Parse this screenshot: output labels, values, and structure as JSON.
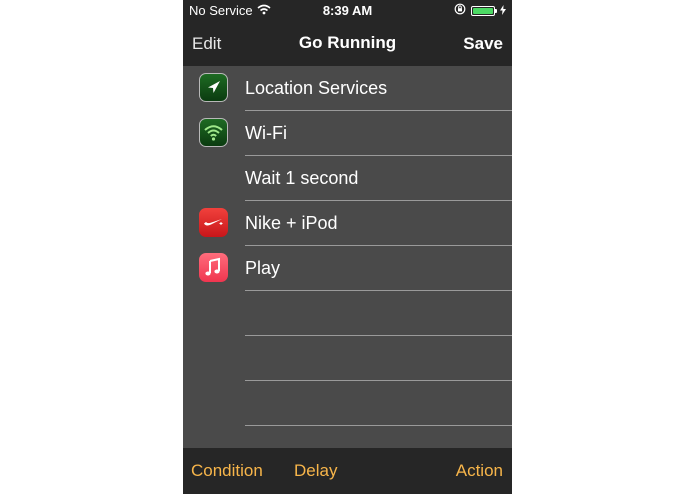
{
  "status_bar": {
    "carrier": "No Service",
    "time": "8:39 AM",
    "battery_level": 1.0,
    "battery_color": "#4cd964"
  },
  "nav": {
    "left_button": "Edit",
    "title": "Go Running",
    "right_button": "Save"
  },
  "actions": [
    {
      "label": "Location Services",
      "icon": "location-arrow-icon"
    },
    {
      "label": "Wi-Fi",
      "icon": "wifi-icon"
    },
    {
      "label": "Wait 1 second",
      "icon": ""
    },
    {
      "label": "Nike + iPod",
      "icon": "nike-icon"
    },
    {
      "label": "Play",
      "icon": "music-note-icon"
    }
  ],
  "toolbar": {
    "condition_label": "Condition",
    "delay_label": "Delay",
    "action_label": "Action",
    "accent_color": "#f7b54a"
  }
}
